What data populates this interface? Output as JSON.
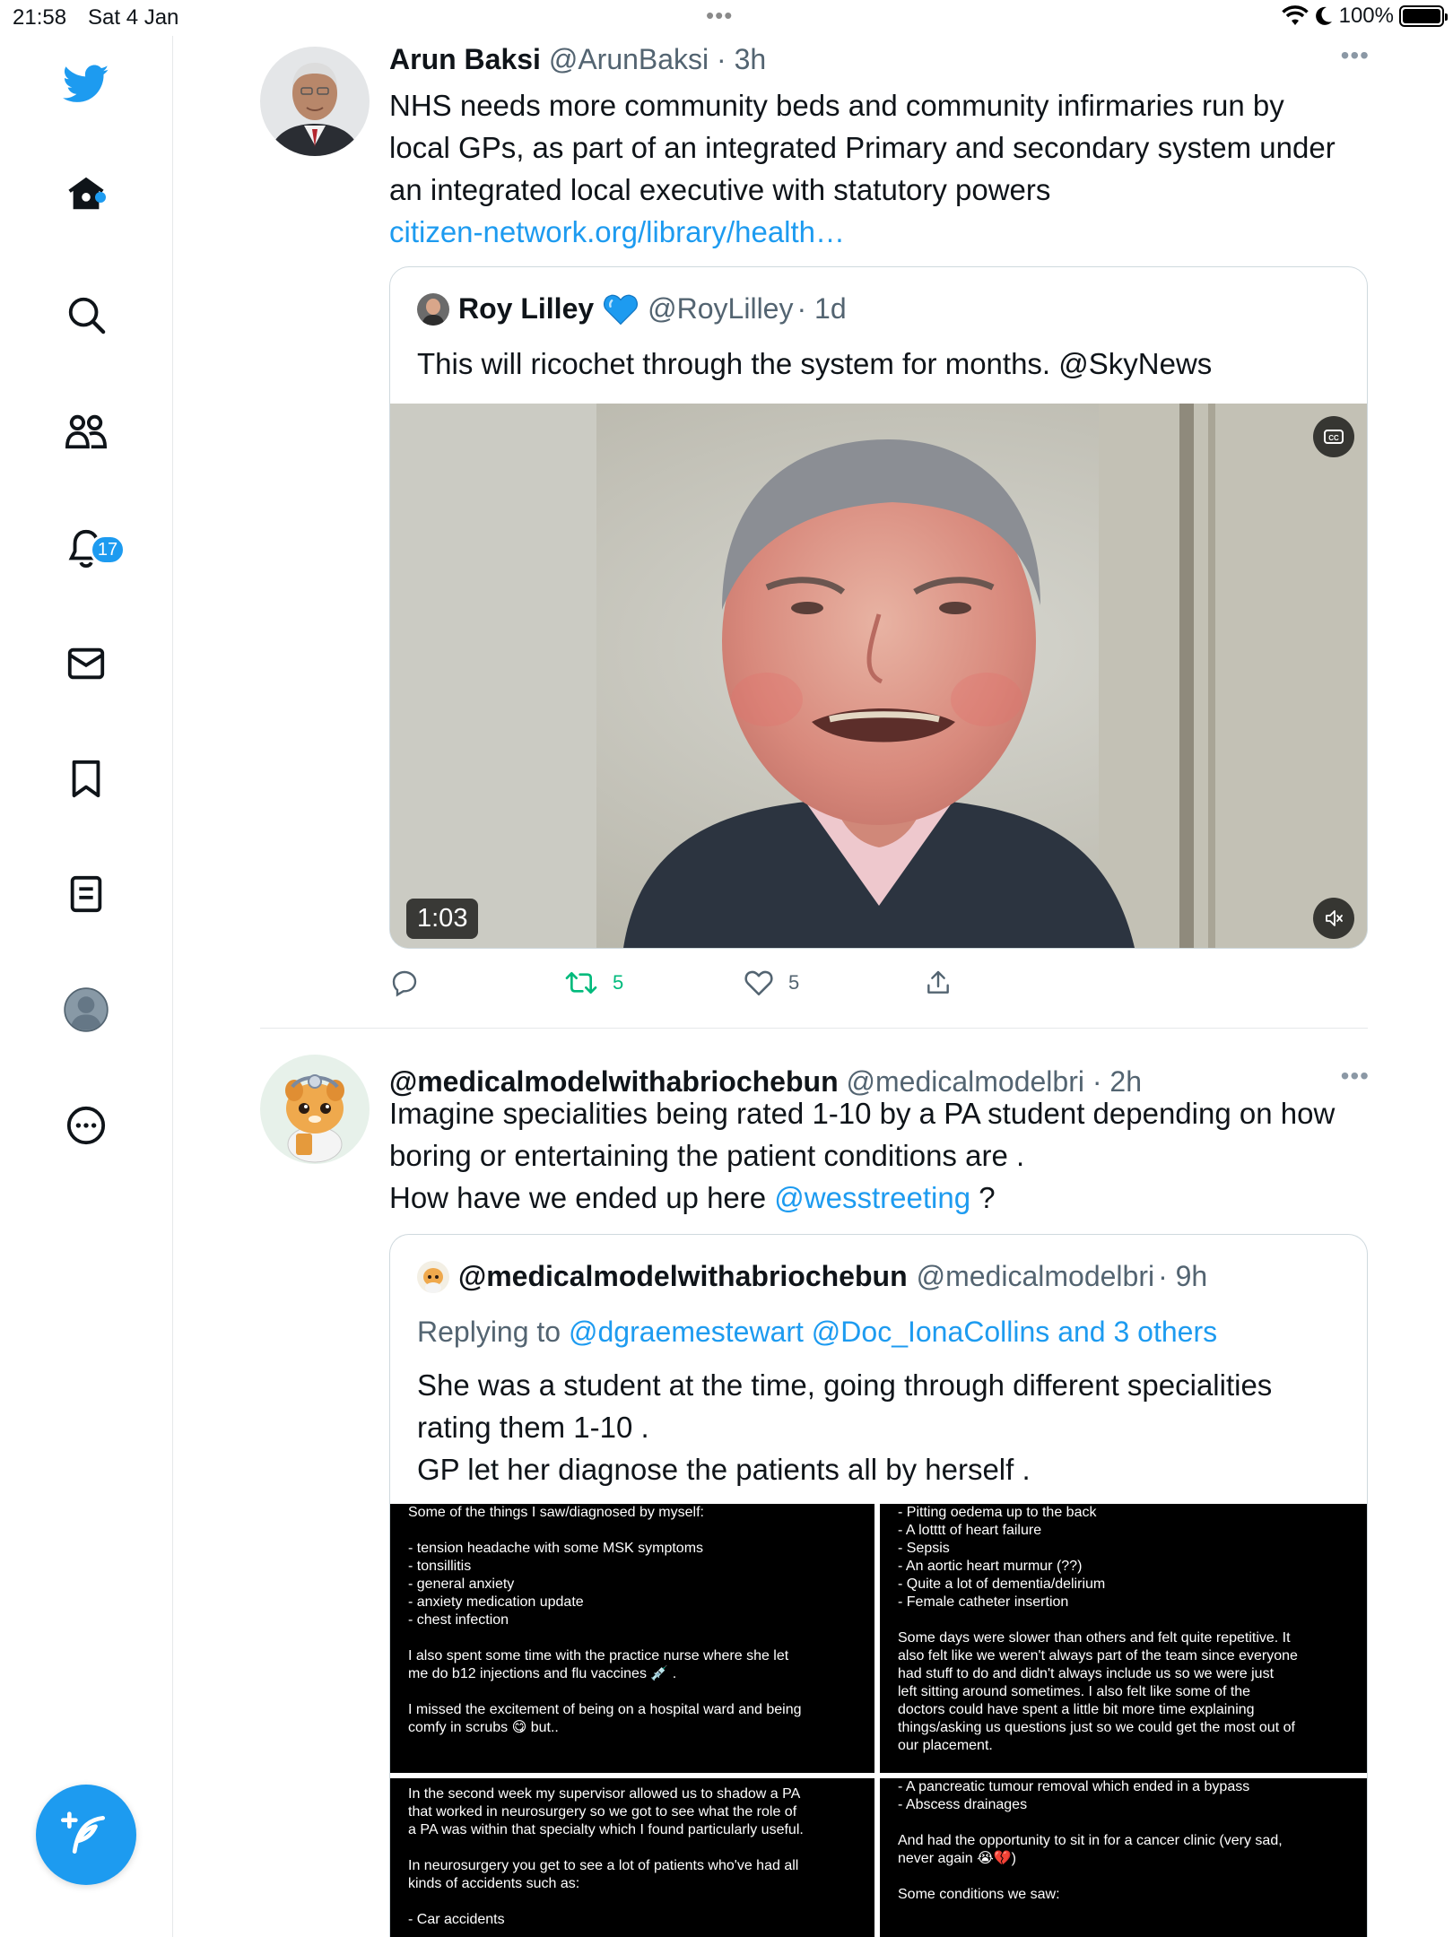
{
  "status_bar": {
    "time": "21:58",
    "date": "Sat 4 Jan",
    "dots": "•••",
    "battery": "100%"
  },
  "sidebar": {
    "items": [
      {
        "icon": "twitter-logo-icon"
      },
      {
        "icon": "home-icon"
      },
      {
        "icon": "search-icon"
      },
      {
        "icon": "communities-icon"
      },
      {
        "icon": "notifications-icon",
        "badge": "17"
      },
      {
        "icon": "messages-icon"
      },
      {
        "icon": "bookmarks-icon"
      },
      {
        "icon": "lists-icon"
      },
      {
        "icon": "profile-icon"
      },
      {
        "icon": "more-icon"
      }
    ],
    "compose_icon": "compose-icon"
  },
  "colors": {
    "accent": "#1d9bf0",
    "text": "#0f1419",
    "muted": "#536471",
    "retweet_green": "#00ba7c",
    "border": "#cfd9de"
  },
  "tweet1": {
    "name": "Arun Baksi",
    "handle": "@ArunBaksi",
    "time": "· 3h",
    "text_lines": [
      "NHS needs more community beds and community infirmaries run by",
      "local GPs, as part of an integrated Primary and secondary system under",
      "an integrated local executive with statutory powers"
    ],
    "link": "citizen-network.org/library/health…",
    "quote": {
      "name": "Roy Lilley",
      "verified_icon": "blue-heart-icon",
      "handle": "@RoyLilley",
      "time": "· 1d",
      "text": "This will ricochet through the system for months. @SkyNews",
      "video_duration": "1:03"
    },
    "actions": {
      "reply_count": "",
      "retweet_count": "5",
      "like_count": "5"
    }
  },
  "tweet2": {
    "name": "@medicalmodelwithabriochebun",
    "handle": "@medicalmodelbri",
    "time": "· 2h",
    "text_line1": "Imagine specialities being rated 1-10 by a PA student depending on how",
    "text_line2": "boring or entertaining the patient conditions are .",
    "text_line3_prefix": "How have we ended up here ",
    "mention": "@wesstreeting",
    "text_line3_suffix": " ?",
    "quote": {
      "name": "@medicalmodelwithabriochebun",
      "handle": "@medicalmodelbri",
      "time": "· 9h",
      "replying_prefix": "Replying to ",
      "replying_to": "@dgraemestewart @Doc_IonaCollins and 3 others",
      "text_lines": [
        "She was a student at the time, going through different specialities",
        "rating them 1-10 .",
        "GP let her diagnose the patients all by herself  ."
      ],
      "images": [
        {
          "lines": [
            "Some of the things I saw/diagnosed by myself:",
            "",
            "- tension headache with some MSK symptoms",
            "- tonsillitis",
            "- general anxiety",
            "- anxiety medication update",
            "- chest infection",
            "",
            "I also spent some time with the practice nurse where she let",
            "me do b12 injections and flu vaccines 💉 .",
            "",
            "I missed the excitement of being on a hospital ward and being",
            "comfy in scrubs 😋 but.."
          ]
        },
        {
          "lines": [
            "- Pitting oedema up to the back",
            "- A lotttt of heart failure",
            "- Sepsis",
            "- An aortic heart murmur (??)",
            "- Quite a lot of dementia/delirium",
            "- Female catheter insertion",
            "",
            "Some days were slower than others and felt quite repetitive. It",
            "also felt like we weren't always part of the team since everyone",
            "had stuff to do and didn't always include us so we were just",
            "left sitting around sometimes. I also felt like some of the",
            "doctors could have spent a little bit more time explaining",
            "things/asking us questions just so we could get the most out of",
            "our placement."
          ]
        },
        {
          "lines": [
            "In the second week my supervisor allowed us to shadow a PA",
            "that worked in neurosurgery so we got to see what the role of",
            "a PA was within that specialty which I found particularly useful.",
            "",
            "In neurosurgery you get to see a lot of patients who've had all",
            "kinds of accidents such as:",
            "",
            "- Car accidents"
          ]
        },
        {
          "lines": [
            "- A pancreatic tumour removal which ended in a bypass",
            "- Abscess drainages",
            "",
            "And had the opportunity to sit in for a cancer clinic (very sad,",
            "never again 😭💔)",
            "",
            "Some conditions we saw:"
          ]
        }
      ]
    }
  }
}
